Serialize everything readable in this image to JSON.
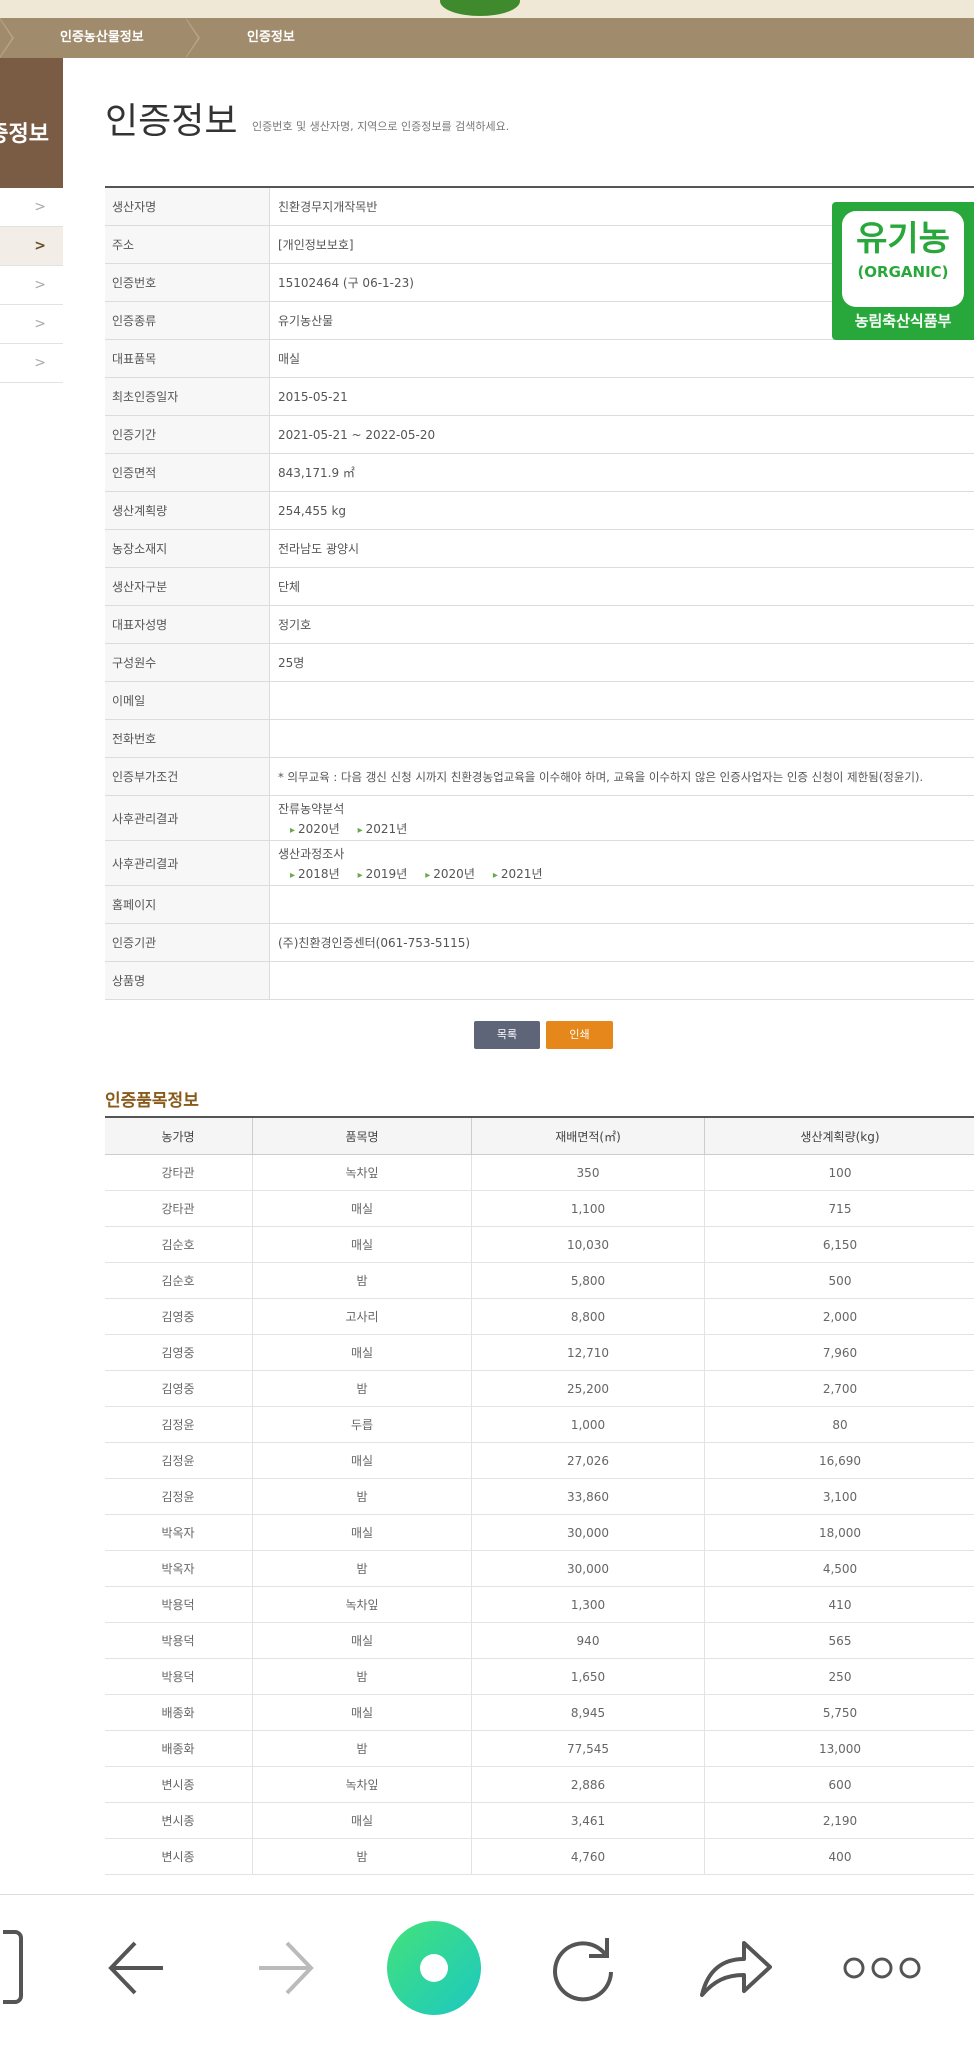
{
  "breadcrumb": {
    "level1": "인증농산물정보",
    "level2": "인증정보"
  },
  "sidebar": {
    "title": "인증정보"
  },
  "page": {
    "title": "인증정보",
    "subtitle": "인증번호 및 생산자명, 지역으로 인증정보를 검색하세요."
  },
  "badge": {
    "main": "유기농",
    "english": "(ORGANIC)",
    "agency": "농림축산식품부",
    "color": "#28a83a"
  },
  "info": {
    "producer_label": "생산자명",
    "producer": "친환경무지개작목반",
    "address_label": "주소",
    "address": "[개인정보보호]",
    "cert_no_label": "인증번호",
    "cert_no": "15102464 (구 06-1-23)",
    "cert_type_label": "인증종류",
    "cert_type": "유기농산물",
    "main_item_label": "대표품목",
    "main_item": "매실",
    "first_cert_label": "최초인증일자",
    "first_cert": "2015-05-21",
    "period_label": "인증기간",
    "period": "2021-05-21 ~ 2022-05-20",
    "area_label": "인증면적",
    "area": "843,171.9 ㎡",
    "plan_label": "생산계획량",
    "plan": "254,455 kg",
    "farm_label": "농장소재지",
    "farm": "전라남도 광양시",
    "division_label": "생산자구분",
    "division": "단체",
    "rep_label": "대표자성명",
    "rep": "정기호",
    "members_label": "구성원수",
    "members": "25명",
    "email_label": "이메일",
    "email": "",
    "phone_label": "전화번호",
    "phone": "",
    "condition_label": "인증부가조건",
    "condition": "* 의무교육 : 다음 갱신 신청 시까지 친환경농업교육을 이수해야 하며, 교육을 이수하지 않은 인증사업자는 인증 신청이 제한됨(정윤기).",
    "post1_label": "사후관리결과",
    "post1_title": "잔류농약분석",
    "post1_years": [
      "2020년",
      "2021년"
    ],
    "post2_label": "사후관리결과",
    "post2_title": "생산과정조사",
    "post2_years": [
      "2018년",
      "2019년",
      "2020년",
      "2021년"
    ],
    "homepage_label": "홈페이지",
    "homepage": "",
    "agency_label": "인증기관",
    "agency": "(주)친환경인증센터(061-753-5115)",
    "product_label": "상품명",
    "product": ""
  },
  "buttons": {
    "list": "목록",
    "print": "인쇄"
  },
  "items": {
    "title": "인증품목정보",
    "headers": [
      "농가명",
      "품목명",
      "재배면적(㎡)",
      "생산계획량(kg)"
    ],
    "rows": [
      [
        "강타관",
        "녹차잎",
        "350",
        "100"
      ],
      [
        "강타관",
        "매실",
        "1,100",
        "715"
      ],
      [
        "김순호",
        "매실",
        "10,030",
        "6,150"
      ],
      [
        "김순호",
        "밤",
        "5,800",
        "500"
      ],
      [
        "김영중",
        "고사리",
        "8,800",
        "2,000"
      ],
      [
        "김영중",
        "매실",
        "12,710",
        "7,960"
      ],
      [
        "김영중",
        "밤",
        "25,200",
        "2,700"
      ],
      [
        "김정윤",
        "두릅",
        "1,000",
        "80"
      ],
      [
        "김정윤",
        "매실",
        "27,026",
        "16,690"
      ],
      [
        "김정윤",
        "밤",
        "33,860",
        "3,100"
      ],
      [
        "박옥자",
        "매실",
        "30,000",
        "18,000"
      ],
      [
        "박옥자",
        "밤",
        "30,000",
        "4,500"
      ],
      [
        "박용덕",
        "녹차잎",
        "1,300",
        "410"
      ],
      [
        "박용덕",
        "매실",
        "940",
        "565"
      ],
      [
        "박용덕",
        "밤",
        "1,650",
        "250"
      ],
      [
        "배종화",
        "매실",
        "8,945",
        "5,750"
      ],
      [
        "배종화",
        "밤",
        "77,545",
        "13,000"
      ],
      [
        "변시종",
        "녹차잎",
        "2,886",
        "600"
      ],
      [
        "변시종",
        "매실",
        "3,461",
        "2,190"
      ],
      [
        "변시종",
        "밤",
        "4,760",
        "400"
      ]
    ]
  },
  "toolbar": {
    "icons": [
      "tabs-icon",
      "back-arrow-icon",
      "forward-arrow-icon",
      "home-icon",
      "reload-icon",
      "share-icon",
      "more-icon"
    ],
    "accent": "#2fd3a0"
  }
}
